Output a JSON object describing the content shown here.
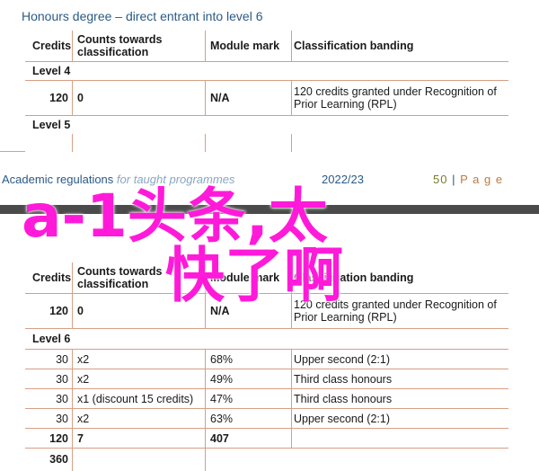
{
  "top_section": {
    "heading": "Honours degree – direct entrant into level 6",
    "headers": {
      "credits": "Credits",
      "counts": "Counts towards classification",
      "module_mark": "Module mark",
      "banding": "Classification banding"
    },
    "level4": {
      "label": "Level 4",
      "credits": "120",
      "counts": "0",
      "mark": "N/A",
      "banding": "120 credits granted under Recognition of Prior Learning (RPL)"
    },
    "level5_label": "Level 5"
  },
  "footer": {
    "left_main": "Academic regulations",
    "left_italic": "for taught programmes",
    "year": "2022/23",
    "page_number": "50",
    "separator": "|",
    "page_word": "P a g e"
  },
  "overlay_text": {
    "line1": "a-1头条,太",
    "line2": "快了啊"
  },
  "bottom_section": {
    "headers": {
      "credits": "Credits",
      "counts": "Counts towards classification",
      "module_mark": "Module mark",
      "banding": "Classification banding"
    },
    "prior_row": {
      "credits": "120",
      "counts": "0",
      "mark": "N/A",
      "banding": "120 credits granted under Recognition of Prior Learning (RPL)"
    },
    "level6_label": "Level 6",
    "rows": [
      {
        "credits": "30",
        "counts": "x2",
        "mark": "68%",
        "banding": "Upper second (2:1)"
      },
      {
        "credits": "30",
        "counts": "x2",
        "mark": "49%",
        "banding": "Third class honours"
      },
      {
        "credits": "30",
        "counts": "x1 (discount 15 credits)",
        "mark": "47%",
        "banding": "Third class honours"
      },
      {
        "credits": "30",
        "counts": "x2",
        "mark": "63%",
        "banding": "Upper second (2:1)"
      }
    ],
    "totals": {
      "credits": "120",
      "counts": "7",
      "mark": "407"
    },
    "grand_total": {
      "credits": "360"
    }
  }
}
